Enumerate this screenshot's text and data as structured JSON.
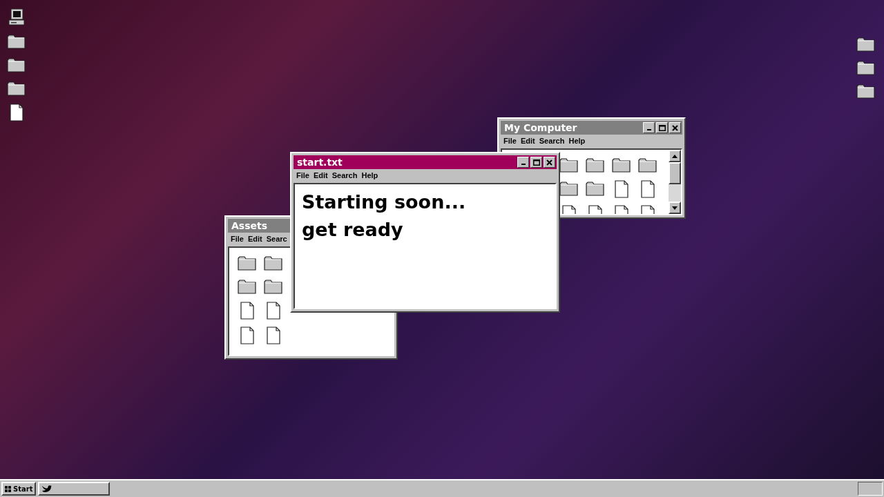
{
  "desktop_icons_left": [
    {
      "kind": "computer"
    },
    {
      "kind": "folder"
    },
    {
      "kind": "folder"
    },
    {
      "kind": "folder"
    },
    {
      "kind": "file"
    }
  ],
  "desktop_icons_right": [
    {
      "kind": "folder"
    },
    {
      "kind": "folder"
    },
    {
      "kind": "folder"
    }
  ],
  "windows": [
    {
      "title": "My Computer",
      "active": false,
      "menu": [
        "File",
        "Edit",
        "Search",
        "Help"
      ],
      "scrollbar": true,
      "rows": [
        [
          {
            "kind": "folder"
          },
          {
            "kind": "folder"
          },
          {
            "kind": "folder"
          },
          {
            "kind": "folder"
          }
        ],
        [
          {
            "kind": "folder"
          },
          {
            "kind": "folder"
          },
          {
            "kind": "file"
          },
          {
            "kind": "file"
          }
        ],
        [
          {
            "kind": "file"
          },
          {
            "kind": "file"
          },
          {
            "kind": "file"
          },
          {
            "kind": "file"
          }
        ]
      ]
    },
    {
      "title": "Assets",
      "active": false,
      "menu": [
        "File",
        "Edit",
        "Searc"
      ],
      "scrollbar": false,
      "rows": [
        [
          {
            "kind": "folder"
          },
          {
            "kind": "folder"
          }
        ],
        [
          {
            "kind": "folder"
          },
          {
            "kind": "folder"
          }
        ],
        [
          {
            "kind": "file"
          },
          {
            "kind": "file"
          }
        ],
        [
          {
            "kind": "file"
          },
          {
            "kind": "file"
          }
        ]
      ]
    },
    {
      "title": "start.txt",
      "active": true,
      "menu": [
        "File",
        "Edit",
        "Search",
        "Help"
      ],
      "text": [
        "Starting soon...",
        "get ready"
      ]
    }
  ],
  "taskbar": {
    "start_label": "Start",
    "tasks": [
      {
        "kind": "bird",
        "selected": false
      }
    ]
  }
}
